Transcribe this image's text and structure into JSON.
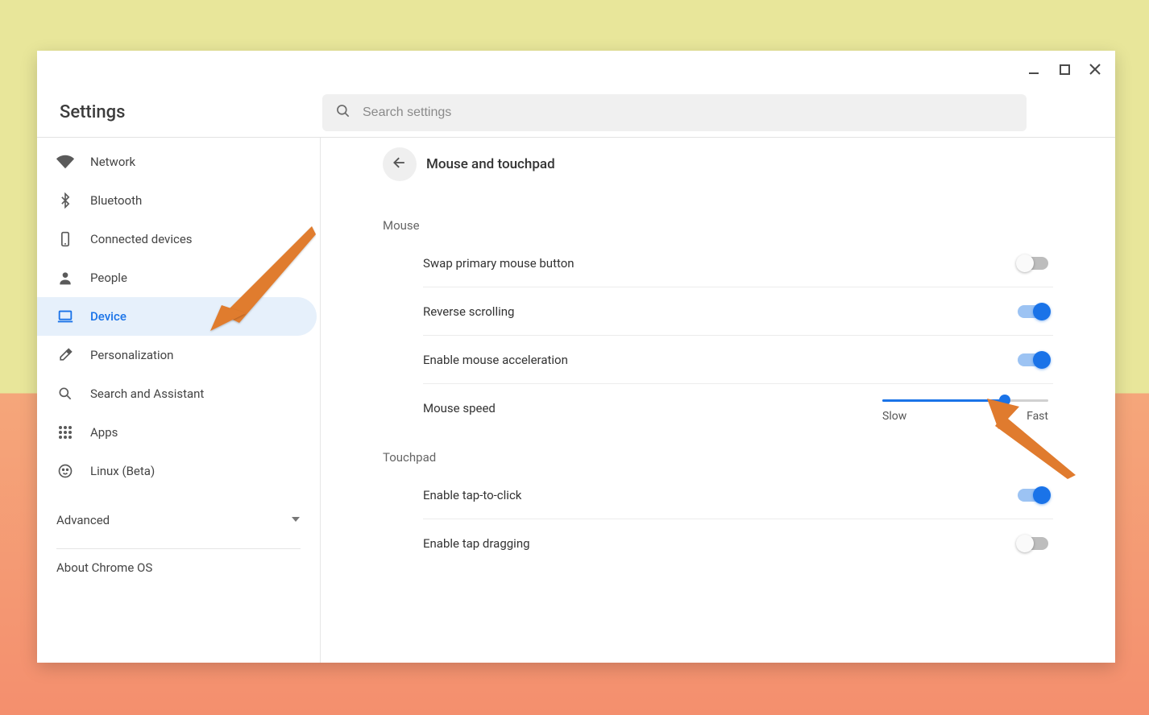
{
  "app": {
    "title": "Settings"
  },
  "search": {
    "placeholder": "Search settings"
  },
  "sidebar": {
    "items": [
      {
        "id": "network",
        "label": "Network"
      },
      {
        "id": "bluetooth",
        "label": "Bluetooth"
      },
      {
        "id": "connected-devices",
        "label": "Connected devices"
      },
      {
        "id": "people",
        "label": "People"
      },
      {
        "id": "device",
        "label": "Device",
        "active": true
      },
      {
        "id": "personalization",
        "label": "Personalization"
      },
      {
        "id": "search-assistant",
        "label": "Search and Assistant"
      },
      {
        "id": "apps",
        "label": "Apps"
      },
      {
        "id": "linux",
        "label": "Linux (Beta)"
      }
    ],
    "advanced_label": "Advanced",
    "about_label": "About Chrome OS"
  },
  "page": {
    "title": "Mouse and touchpad",
    "sections": {
      "mouse": {
        "title": "Mouse",
        "swap_label": "Swap primary mouse button",
        "swap_on": false,
        "reverse_label": "Reverse scrolling",
        "reverse_on": true,
        "accel_label": "Enable mouse acceleration",
        "accel_on": true,
        "speed_label": "Mouse speed",
        "speed_slow": "Slow",
        "speed_fast": "Fast",
        "speed_percent": 74
      },
      "touchpad": {
        "title": "Touchpad",
        "tap_label": "Enable tap-to-click",
        "tap_on": true,
        "drag_label": "Enable tap dragging",
        "drag_on": false
      }
    }
  }
}
